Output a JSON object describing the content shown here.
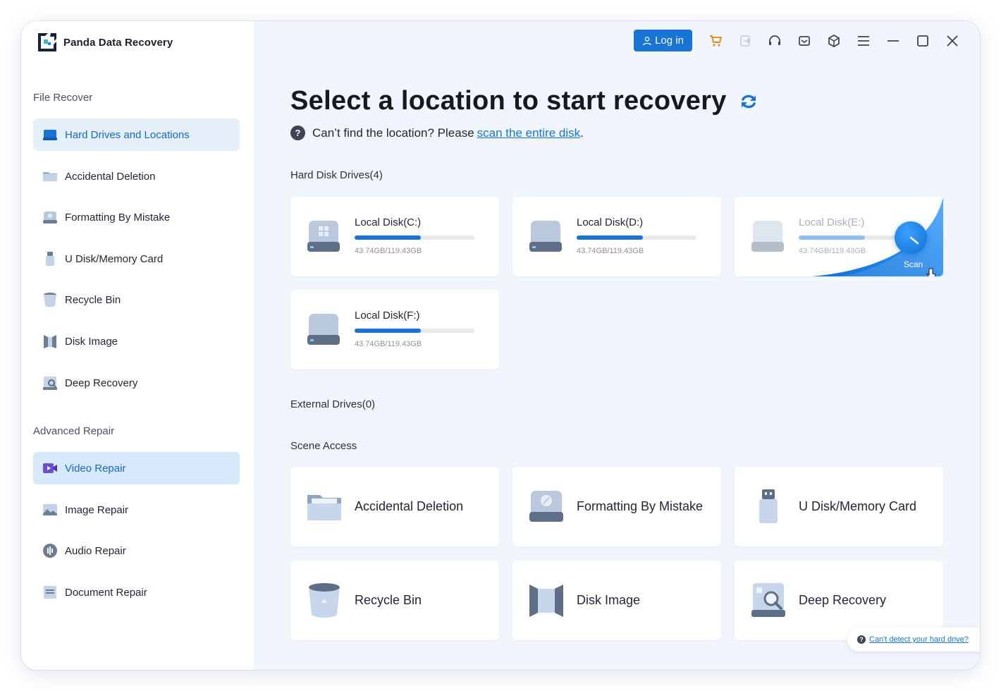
{
  "app": {
    "title": "Panda Data Recovery"
  },
  "sidebar": {
    "sections": [
      {
        "title": "File Recover"
      },
      {
        "title": "Advanced Repair"
      }
    ],
    "file_recover": [
      {
        "label": "Hard Drives and Locations",
        "icon": "hard-drive-icon",
        "active": true
      },
      {
        "label": "Accidental Deletion",
        "icon": "folder-icon"
      },
      {
        "label": "Formatting By Mistake",
        "icon": "formatted-disk-icon"
      },
      {
        "label": "U Disk/Memory Card",
        "icon": "usb-drive-icon"
      },
      {
        "label": "Recycle Bin",
        "icon": "recycle-bin-icon"
      },
      {
        "label": "Disk Image",
        "icon": "disk-image-icon"
      },
      {
        "label": "Deep Recovery",
        "icon": "deep-recovery-icon"
      }
    ],
    "advanced_repair": [
      {
        "label": "Video Repair",
        "icon": "video-icon",
        "hover": true
      },
      {
        "label": "Image Repair",
        "icon": "image-icon"
      },
      {
        "label": "Audio Repair",
        "icon": "audio-icon"
      },
      {
        "label": "Document Repair",
        "icon": "document-icon"
      }
    ]
  },
  "topbar": {
    "login_label": "Log in",
    "icons": [
      "cart-icon",
      "export-icon",
      "headset-icon",
      "mail-icon",
      "box-icon",
      "menu-icon",
      "minimize-icon",
      "maximize-icon",
      "close-icon"
    ]
  },
  "main": {
    "headline": "Select a location to start recovery",
    "hint_text": "Can’t find the location?  Please",
    "hint_link": "scan the entire disk",
    "hint_end": ".",
    "hard_disk_title": "Hard Disk Drives(4)",
    "disks": [
      {
        "name": "Local Disk(C:)",
        "size": "43.74GB/119.43GB",
        "used_fraction": 0.55
      },
      {
        "name": "Local Disk(D:)",
        "size": "43.74GB/119.43GB",
        "used_fraction": 0.55
      },
      {
        "name": "Local Disk(E:)",
        "size": "43.74GB/119.43GB",
        "used_fraction": 0.55,
        "hover": true,
        "scan_label": "Scan"
      },
      {
        "name": "Local Disk(F:)",
        "size": "43.74GB/119.43GB",
        "used_fraction": 0.55
      }
    ],
    "external_title": "External Drives(0)",
    "scene_title": "Scene Access",
    "scenes": [
      {
        "label": "Accidental Deletion",
        "icon": "folder-icon"
      },
      {
        "label": "Formatting By Mistake",
        "icon": "formatted-disk-icon"
      },
      {
        "label": "U Disk/Memory Card",
        "icon": "usb-drive-icon"
      },
      {
        "label": "Recycle Bin",
        "icon": "recycle-bin-icon"
      },
      {
        "label": "Disk Image",
        "icon": "disk-image-icon"
      },
      {
        "label": "Deep Recovery",
        "icon": "deep-recovery-icon"
      }
    ],
    "help_link": "Can't detect your hard drive?"
  },
  "colors": {
    "accent": "#1874d2",
    "bg": "#f1f6fc"
  }
}
